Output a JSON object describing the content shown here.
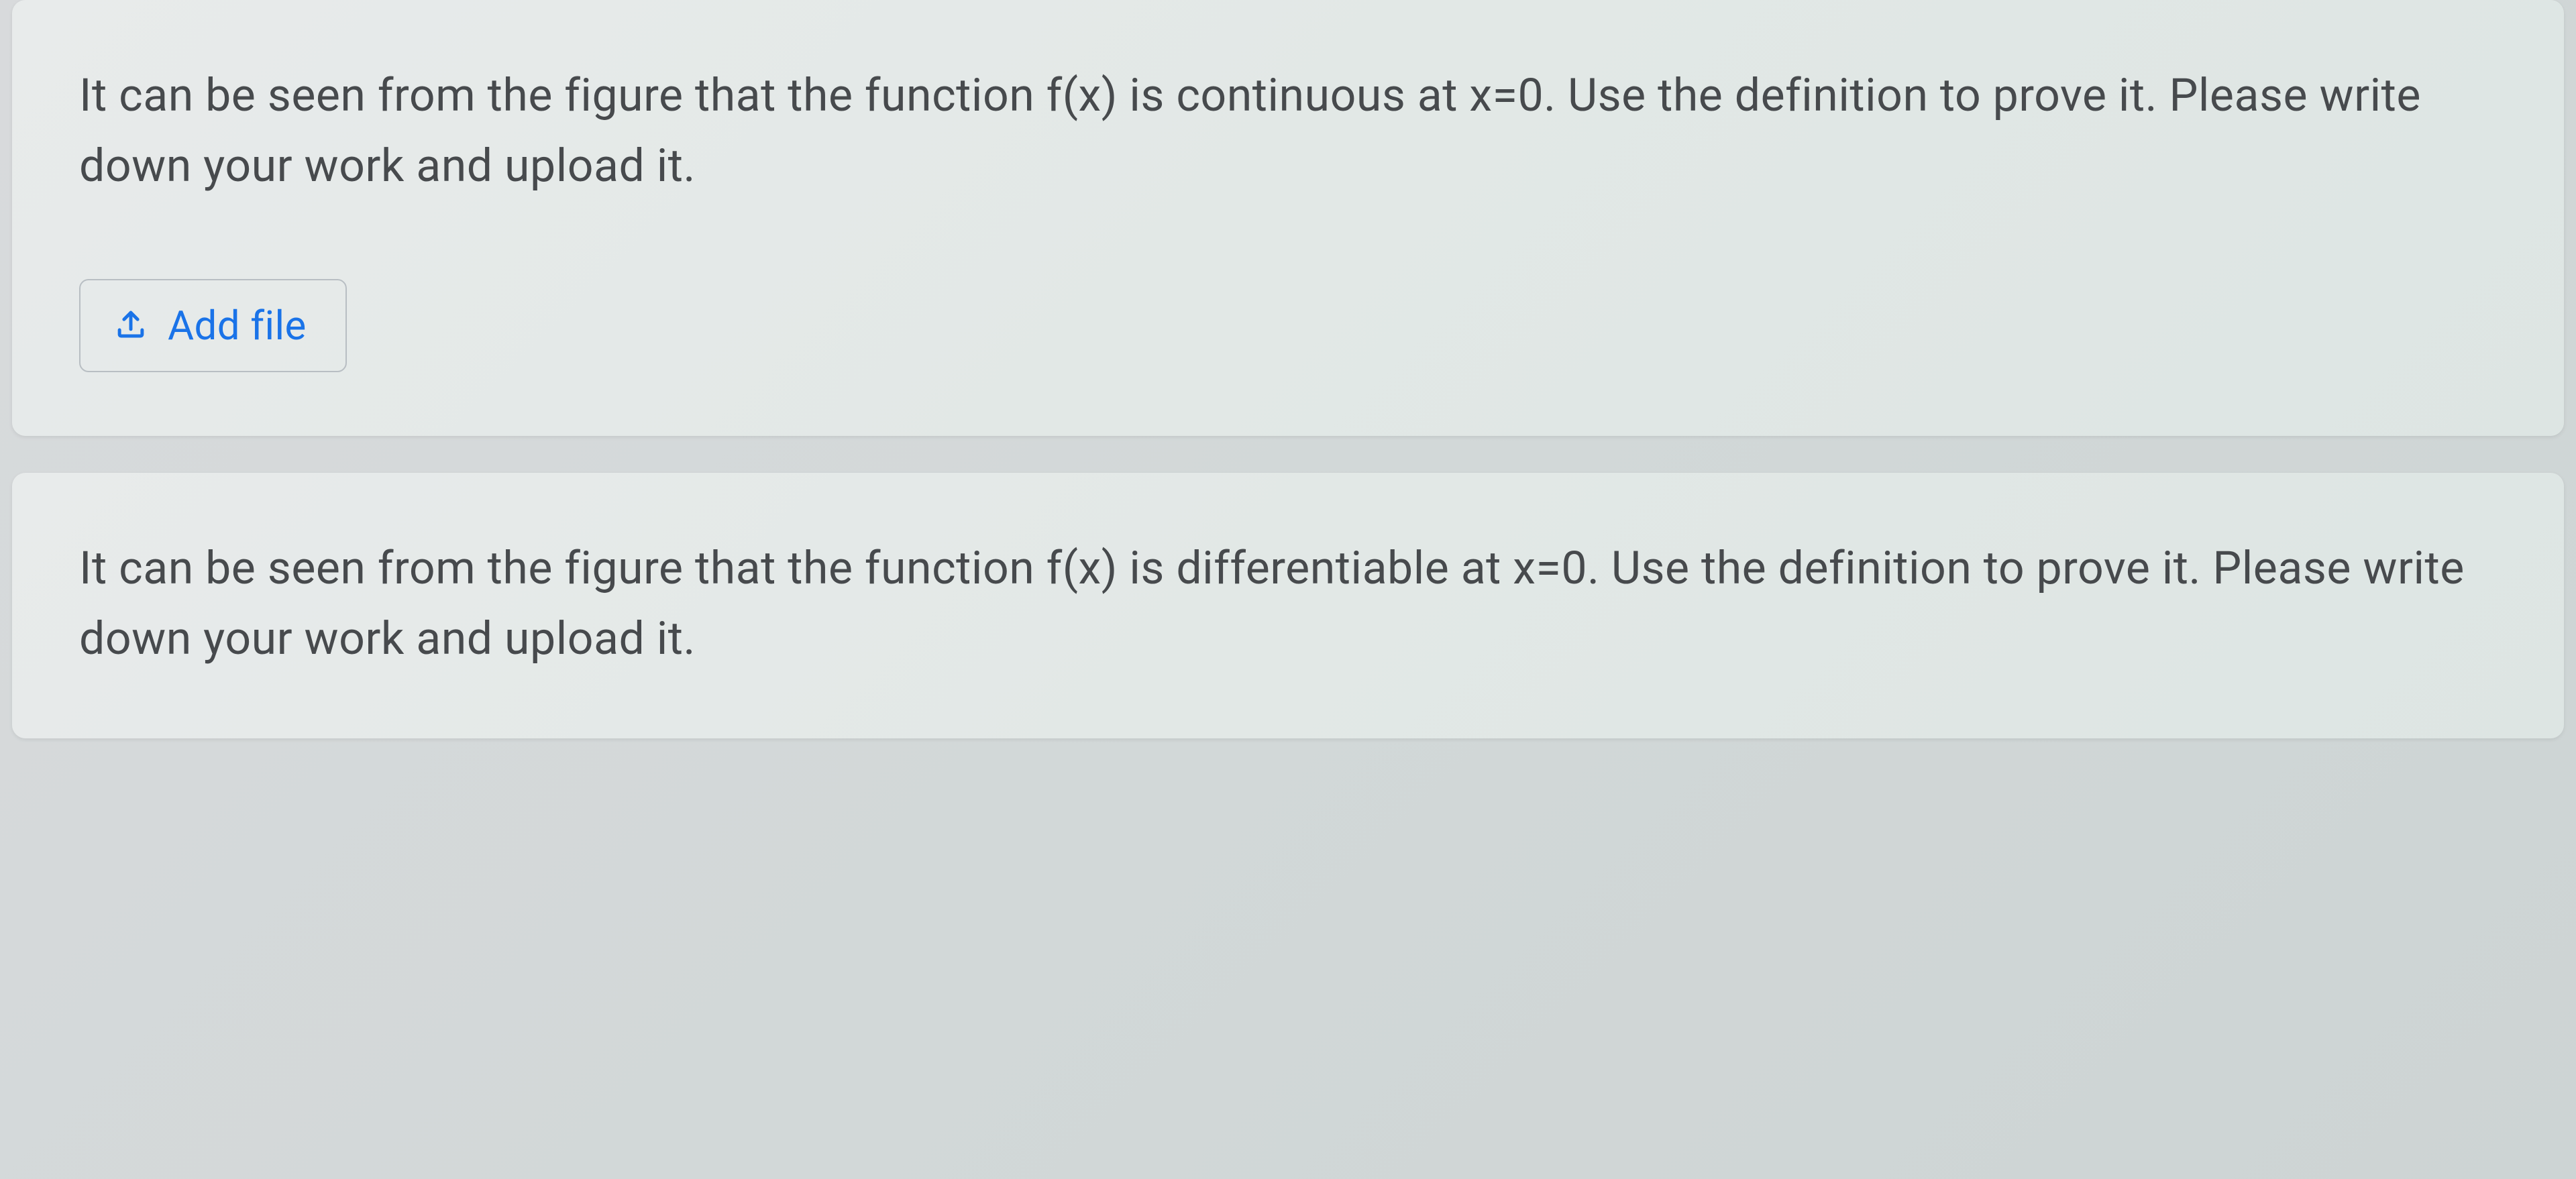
{
  "questions": [
    {
      "text": "It can be seen from the figure that the function f(x) is continuous at x=0. Use the definition to prove it. Please write down your work and upload it.",
      "showAddFile": true
    },
    {
      "text": "It can be seen from the figure that the function f(x) is differentiable at x=0. Use the definition to prove it. Please write down your work and upload it.",
      "showAddFile": false
    }
  ],
  "addFileButton": {
    "label": "Add file"
  }
}
